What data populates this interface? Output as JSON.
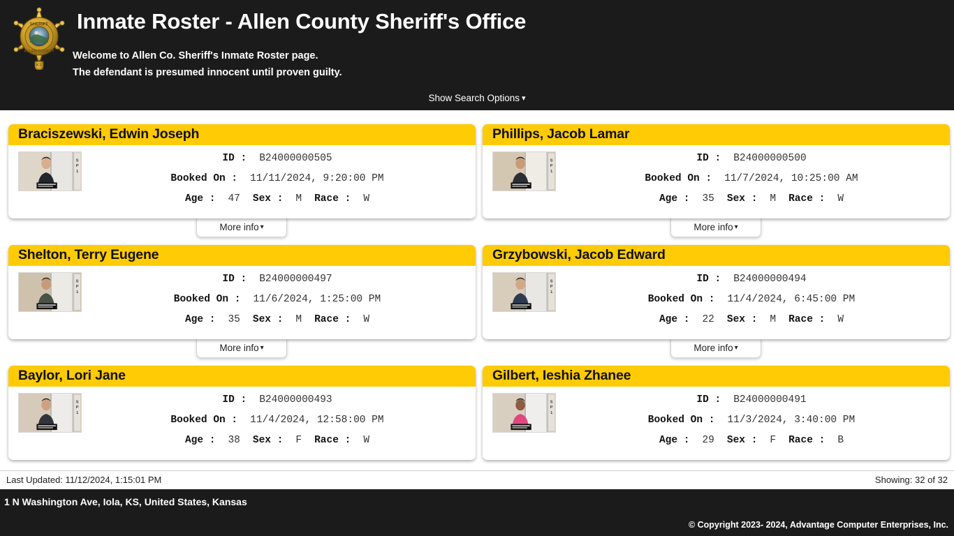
{
  "header": {
    "title": "Inmate Roster - Allen County Sheriff's Office",
    "welcome_line1": "Welcome to Allen Co. Sheriff's Inmate Roster page.",
    "welcome_line2": "The defendant is presumed innocent until proven guilty.",
    "search_toggle_label": "Show Search Options",
    "search_toggle_icon": "chevron-down-icon",
    "badge_icon": "sheriff-star-badge-icon",
    "badge_text_top": "SHERIFF",
    "badge_text_bottom": "ALLEN COUNTY",
    "badge_text_state": "KS",
    "background_color": "#1b1b1b",
    "text_color": "#ffffff"
  },
  "labels": {
    "id": "ID :",
    "booked_on": "Booked On :",
    "age": "Age :",
    "sex": "Sex :",
    "race": "Race :",
    "more_info": "More info",
    "more_info_icon": "chevron-down-icon"
  },
  "theme": {
    "accent_yellow": "#ffcb05",
    "card_background": "#ffffff",
    "page_background": "#ffffff"
  },
  "inmates": [
    {
      "name": "Braciszewski, Edwin Joseph",
      "id": "B24000000505",
      "booked_on": "11/11/2024, 9:20:00 PM",
      "age": "47",
      "sex": "M",
      "race": "W",
      "mugshot": "mugshot-photo",
      "has_more_info": true
    },
    {
      "name": "Phillips, Jacob Lamar",
      "id": "B24000000500",
      "booked_on": "11/7/2024, 10:25:00 AM",
      "age": "35",
      "sex": "M",
      "race": "W",
      "mugshot": "mugshot-photo",
      "has_more_info": true
    },
    {
      "name": "Shelton, Terry Eugene",
      "id": "B24000000497",
      "booked_on": "11/6/2024, 1:25:00 PM",
      "age": "35",
      "sex": "M",
      "race": "W",
      "mugshot": "mugshot-photo",
      "has_more_info": true
    },
    {
      "name": "Grzybowski, Jacob Edward",
      "id": "B24000000494",
      "booked_on": "11/4/2024, 6:45:00 PM",
      "age": "22",
      "sex": "M",
      "race": "W",
      "mugshot": "mugshot-photo",
      "has_more_info": true
    },
    {
      "name": "Baylor, Lori Jane",
      "id": "B24000000493",
      "booked_on": "11/4/2024, 12:58:00 PM",
      "age": "38",
      "sex": "F",
      "race": "W",
      "mugshot": "mugshot-photo",
      "has_more_info": false
    },
    {
      "name": "Gilbert, Ieshia Zhanee",
      "id": "B24000000491",
      "booked_on": "11/3/2024, 3:40:00 PM",
      "age": "29",
      "sex": "F",
      "race": "B",
      "mugshot": "mugshot-photo",
      "has_more_info": false
    }
  ],
  "status_bar": {
    "last_updated": "Last Updated: 11/12/2024, 1:15:01 PM",
    "showing": "Showing: 32 of 32"
  },
  "footer": {
    "address": "1 N Washington Ave, Iola, KS, United States, Kansas",
    "copyright": "© Copyright 2023- 2024, Advantage Computer Enterprises, Inc."
  }
}
